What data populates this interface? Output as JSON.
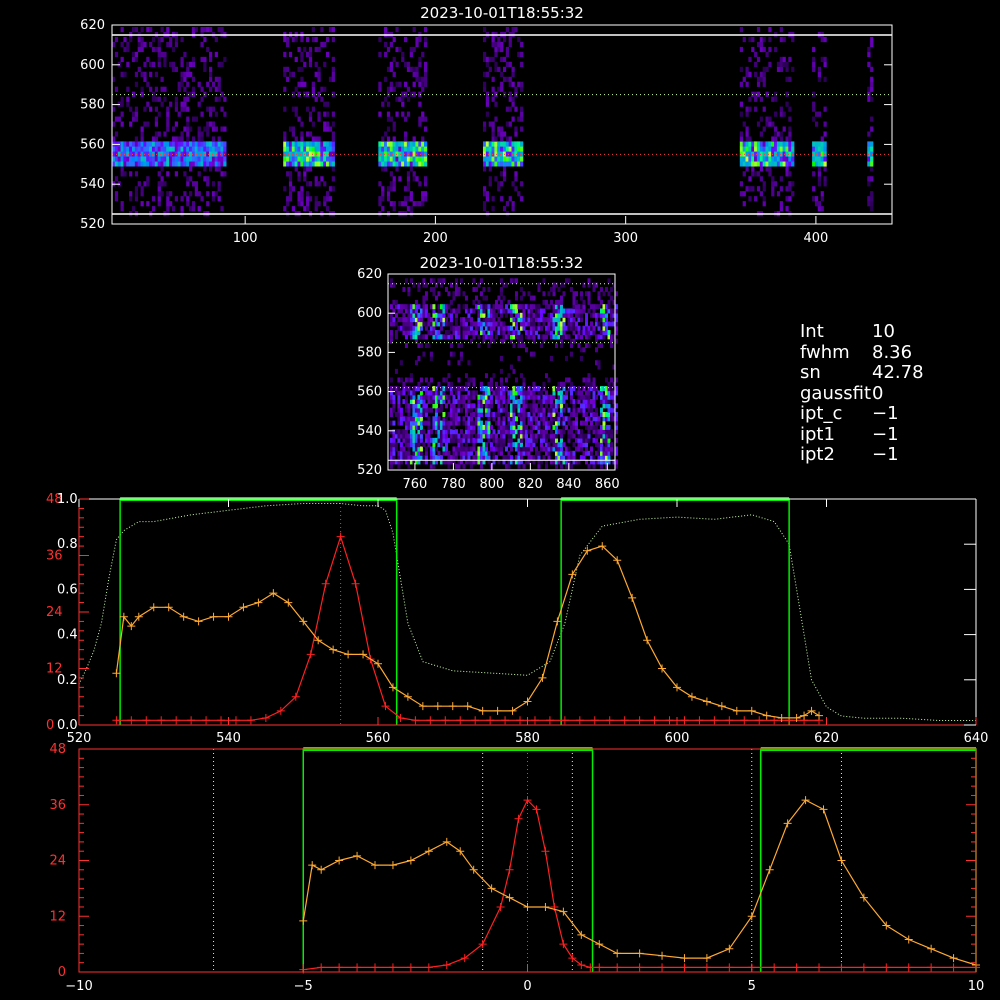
{
  "panels": {
    "top_image": {
      "title": "2023-10-01T18:55:32",
      "y_ticks": [
        "520",
        "540",
        "560",
        "580",
        "600",
        "620"
      ],
      "x_ticks": [
        "100",
        "200",
        "300",
        "400"
      ]
    },
    "mid_image": {
      "title": "2023-10-01T18:55:32",
      "y_ticks": [
        "520",
        "540",
        "560",
        "580",
        "600",
        "620"
      ],
      "x_ticks": [
        "760",
        "780",
        "800",
        "820",
        "840",
        "860"
      ]
    },
    "info": [
      {
        "key": "Int",
        "value": "10"
      },
      {
        "key": "fwhm",
        "value": "8.36"
      },
      {
        "key": "sn",
        "value": "42.78"
      },
      {
        "key": "gaussfit",
        "value": "0"
      },
      {
        "key": "ipt_c",
        "value": "−1"
      },
      {
        "key": "ipt1",
        "value": "−1"
      },
      {
        "key": "ipt2",
        "value": "−1"
      }
    ]
  },
  "colors": {
    "accent_green": "#00ee00",
    "red_series": "#ff2020",
    "orange_series": "#ffaa33",
    "red_axis": "#ff3030",
    "ref_line": "#ccffaa"
  },
  "chart_data": [
    {
      "type": "heatmap",
      "title": "2023-10-01T18:55:32",
      "xlim": [
        30,
        440
      ],
      "ylim": [
        520,
        620
      ],
      "hlines": [
        525,
        555,
        585,
        615
      ],
      "active_columns": [
        [
          30,
          90
        ],
        [
          120,
          147
        ],
        [
          170,
          195
        ],
        [
          225,
          245
        ],
        [
          360,
          388
        ],
        [
          398,
          405
        ],
        [
          427,
          430
        ]
      ],
      "bright_row": 554
    },
    {
      "type": "heatmap",
      "title": "2023-10-01T18:55:32",
      "xlim": [
        746,
        864
      ],
      "ylim": [
        520,
        620
      ],
      "hlines": [
        585,
        615
      ]
    },
    {
      "type": "line",
      "xlim": [
        520,
        640
      ],
      "x_ticks": [
        520,
        540,
        560,
        580,
        600,
        620,
        640
      ],
      "ylim_left": [
        0,
        1.0
      ],
      "left_ticks": [
        "0.0",
        "0.2",
        "0.4",
        "0.6",
        "0.8",
        "1.0"
      ],
      "ylim_right": [
        0,
        48
      ],
      "right_ticks": [
        "0",
        "12",
        "24",
        "36",
        "48"
      ],
      "green_windows": [
        [
          525.5,
          562.5
        ],
        [
          584.5,
          615
        ]
      ],
      "vline_red": 555,
      "transmission": {
        "x": [
          520,
          521,
          522,
          523,
          524,
          525,
          526,
          527,
          528,
          530,
          535,
          540,
          545,
          550,
          555,
          558,
          560,
          561,
          562,
          563,
          564,
          566,
          570,
          575,
          580,
          583,
          585,
          587,
          590,
          595,
          600,
          605,
          610,
          613,
          615,
          616,
          617,
          618,
          620,
          622,
          625,
          630,
          635,
          640
        ],
        "y": [
          0.18,
          0.25,
          0.33,
          0.45,
          0.65,
          0.82,
          0.86,
          0.88,
          0.9,
          0.9,
          0.93,
          0.95,
          0.97,
          0.98,
          0.98,
          0.97,
          0.97,
          0.95,
          0.85,
          0.65,
          0.45,
          0.28,
          0.24,
          0.23,
          0.22,
          0.28,
          0.45,
          0.75,
          0.88,
          0.91,
          0.92,
          0.91,
          0.93,
          0.9,
          0.8,
          0.6,
          0.4,
          0.2,
          0.08,
          0.04,
          0.03,
          0.03,
          0.02,
          0.02
        ]
      },
      "series": [
        {
          "x": [
            525,
            527,
            529,
            531,
            533,
            535,
            537,
            539,
            541,
            543,
            545,
            547,
            549,
            551,
            553,
            555,
            557,
            559,
            561,
            563,
            565,
            567,
            569,
            571,
            573,
            575,
            577,
            579,
            581,
            583,
            585,
            587,
            589,
            591,
            593,
            595,
            597,
            599,
            601,
            603,
            605,
            607,
            609,
            611,
            613,
            615,
            617,
            619
          ],
          "y": [
            1,
            1,
            1,
            1,
            1,
            1,
            1,
            1,
            1,
            1,
            1.5,
            3,
            6,
            15,
            30,
            40,
            30,
            14,
            4,
            1.5,
            1,
            1,
            1,
            1,
            1,
            1,
            1,
            1,
            1,
            1,
            1,
            1,
            1,
            1,
            1,
            1,
            1,
            1,
            1,
            1,
            1,
            1,
            1,
            1,
            1,
            1,
            1,
            1
          ]
        },
        {
          "x": [
            525,
            526,
            527,
            528,
            530,
            532,
            534,
            536,
            538,
            540,
            542,
            544,
            546,
            548,
            550,
            552,
            554,
            556,
            558,
            560,
            562,
            564,
            566,
            568,
            570,
            572,
            574,
            576,
            578,
            580,
            582,
            584,
            586,
            588,
            590,
            592,
            594,
            596,
            598,
            600,
            602,
            604,
            606,
            608,
            610,
            612,
            614,
            616,
            617,
            618,
            619
          ],
          "y": [
            11,
            23,
            21,
            23,
            25,
            25,
            23,
            22,
            23,
            23,
            25,
            26,
            28,
            26,
            22,
            18,
            16,
            15,
            15,
            13,
            8,
            6,
            4,
            4,
            4,
            4,
            3,
            3,
            3,
            5,
            10,
            22,
            32,
            37,
            38,
            35,
            27,
            18,
            12,
            8,
            6,
            5,
            4,
            3,
            3,
            2,
            1.5,
            1.5,
            2,
            3,
            2
          ]
        }
      ]
    },
    {
      "type": "line",
      "xlim": [
        -10,
        10
      ],
      "x_ticks": [
        "−10",
        "−5",
        "0",
        "5",
        "10"
      ],
      "x_tick_values": [
        -10,
        -5,
        0,
        5,
        10
      ],
      "ylim": [
        0,
        48
      ],
      "y_ticks": [
        "0",
        "12",
        "24",
        "36",
        "48"
      ],
      "green_windows": [
        [
          -5,
          1.45
        ],
        [
          5.2,
          10
        ]
      ],
      "vlines_dotted": [
        -7,
        -1,
        1,
        5,
        7
      ],
      "vline_red": 0,
      "series": [
        {
          "x": [
            -5,
            -4.6,
            -4.2,
            -3.8,
            -3.4,
            -3.0,
            -2.6,
            -2.2,
            -1.8,
            -1.4,
            -1.0,
            -0.6,
            -0.4,
            -0.2,
            0,
            0.2,
            0.4,
            0.6,
            0.8,
            1.0,
            1.2,
            1.4,
            1.6,
            2.0,
            2.5,
            3.0,
            3.5,
            4.0,
            4.5,
            5.0,
            5.5,
            6.0,
            6.5,
            7.0,
            7.5,
            8.0,
            8.5,
            9.0,
            9.5,
            10.0
          ],
          "y": [
            0.5,
            1,
            1,
            1,
            1,
            1,
            1,
            1,
            1.5,
            3,
            6,
            14,
            22,
            33,
            37,
            35,
            26,
            14,
            6,
            3,
            1.5,
            1,
            1,
            1,
            1,
            1,
            1,
            1,
            1,
            1,
            1,
            1,
            1,
            1,
            1,
            1,
            1,
            1,
            1,
            1
          ]
        },
        {
          "x": [
            -5,
            -4.8,
            -4.6,
            -4.2,
            -3.8,
            -3.4,
            -3.0,
            -2.6,
            -2.2,
            -1.8,
            -1.5,
            -1.2,
            -0.8,
            -0.4,
            0,
            0.4,
            0.8,
            1.2,
            1.6,
            2.0,
            2.5,
            3.0,
            3.5,
            4.0,
            4.5,
            5.0,
            5.4,
            5.8,
            6.2,
            6.6,
            7.0,
            7.5,
            8.0,
            8.5,
            9.0,
            9.5,
            10.0
          ],
          "y": [
            11,
            23,
            22,
            24,
            25,
            23,
            23,
            24,
            26,
            28,
            26,
            22,
            18,
            16,
            14,
            14,
            13,
            8,
            6,
            4,
            4,
            3.5,
            3,
            3,
            5,
            12,
            22,
            32,
            37,
            35,
            24,
            16,
            10,
            7,
            5,
            3,
            1.5
          ]
        }
      ]
    }
  ]
}
